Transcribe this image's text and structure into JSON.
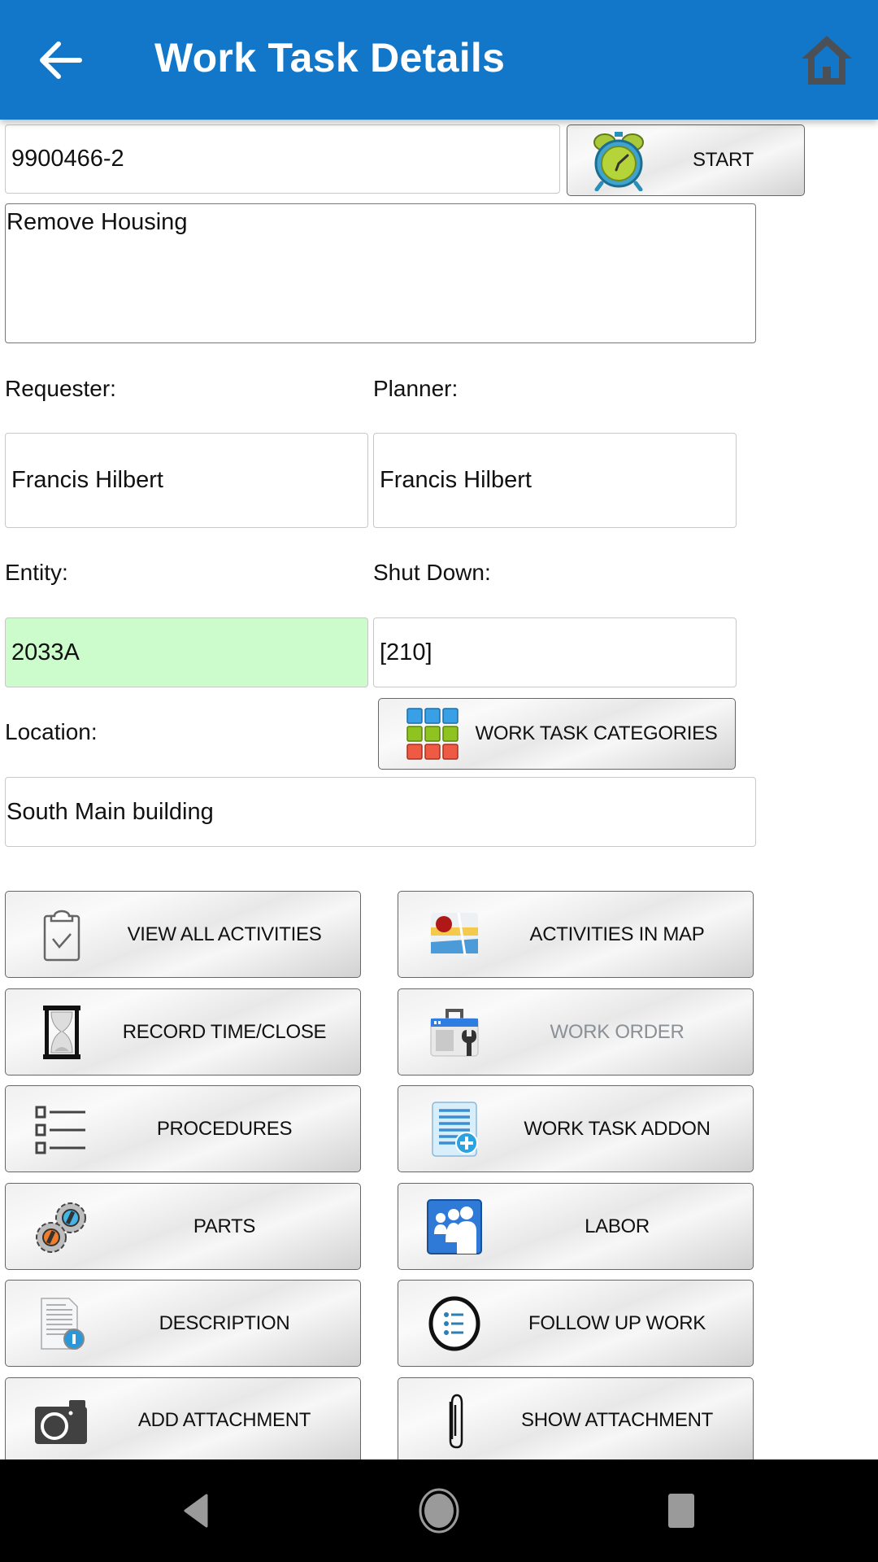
{
  "header": {
    "title": "Work Task Details",
    "back_icon": "arrow-left-icon",
    "home_icon": "home-icon",
    "background_color": "#1277c9"
  },
  "task": {
    "id_value": "9900466-2",
    "start_button_label": "START",
    "description_value": "Remove Housing",
    "requester_label": "Requester:",
    "requester_value": "Francis Hilbert",
    "planner_label": "Planner:",
    "planner_value": "Francis Hilbert",
    "entity_label": "Entity:",
    "entity_value": "2033A",
    "entity_highlight_color": "#ccfccc",
    "shutdown_label": "Shut Down:",
    "shutdown_value": "[210]",
    "location_label": "Location:",
    "categories_button_label": "WORK TASK CATEGORIES",
    "location_value": "South Main building"
  },
  "actions": [
    {
      "label": "VIEW ALL ACTIVITIES",
      "icon": "clipboard-check-icon",
      "enabled": true
    },
    {
      "label": "ACTIVITIES IN MAP",
      "icon": "map-icon",
      "enabled": true
    },
    {
      "label": "RECORD TIME/CLOSE",
      "icon": "hourglass-icon",
      "enabled": true
    },
    {
      "label": "WORK ORDER",
      "icon": "toolbox-wrench-icon",
      "enabled": false
    },
    {
      "label": "PROCEDURES",
      "icon": "checklist-icon",
      "enabled": true
    },
    {
      "label": "WORK TASK ADDON",
      "icon": "document-add-icon",
      "enabled": true
    },
    {
      "label": "PARTS",
      "icon": "gears-icon",
      "enabled": true
    },
    {
      "label": "LABOR",
      "icon": "people-icon",
      "enabled": true
    },
    {
      "label": "DESCRIPTION",
      "icon": "document-info-icon",
      "enabled": true
    },
    {
      "label": "FOLLOW UP WORK",
      "icon": "list-circle-icon",
      "enabled": true
    },
    {
      "label": "ADD ATTACHMENT",
      "icon": "camera-icon",
      "enabled": true
    },
    {
      "label": "SHOW ATTACHMENT",
      "icon": "paperclip-icon",
      "enabled": true
    }
  ],
  "system_nav": {
    "back": "nav-back-icon",
    "home": "nav-home-icon",
    "recents": "nav-recents-icon"
  }
}
